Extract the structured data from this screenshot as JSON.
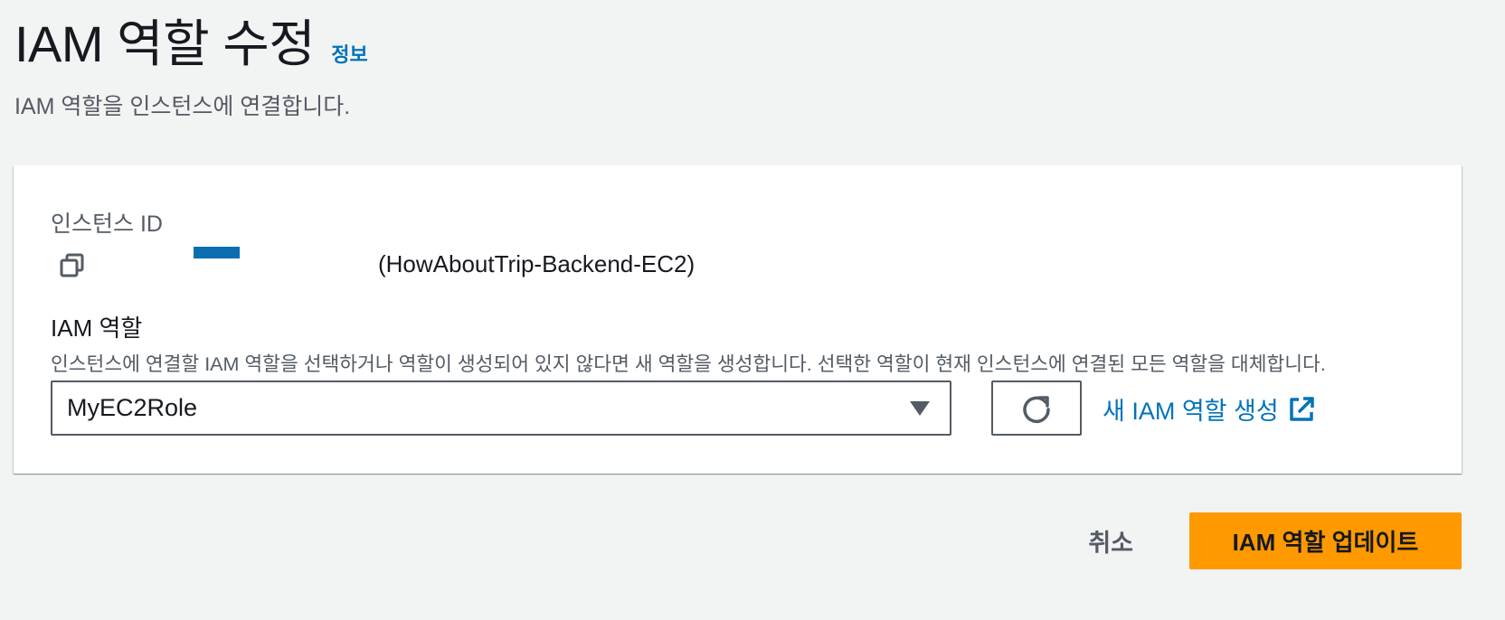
{
  "header": {
    "title": "IAM 역할 수정",
    "info_link": "정보",
    "description": "IAM 역할을 인스턴스에 연결합니다."
  },
  "instance": {
    "label": "인스턴스 ID",
    "name": "(HowAboutTrip-Backend-EC2)",
    "copy_icon": "copy-icon"
  },
  "iam_role": {
    "label": "IAM 역할",
    "description": "인스턴스에 연결할 IAM 역할을 선택하거나 역할이 생성되어 있지 않다면 새 역할을 생성합니다. 선택한 역할이 현재 인스턴스에 연결된 모든 역할을 대체합니다.",
    "selected_value": "MyEC2Role",
    "create_link": "새 IAM 역할 생성",
    "refresh_icon": "refresh-icon",
    "external_icon": "external-link-icon"
  },
  "footer": {
    "cancel_label": "취소",
    "submit_label": "IAM 역할 업데이트"
  },
  "colors": {
    "link": "#0073bb",
    "primary": "#ff9900",
    "background": "#f2f3f3",
    "redaction": "#0b6db2"
  }
}
